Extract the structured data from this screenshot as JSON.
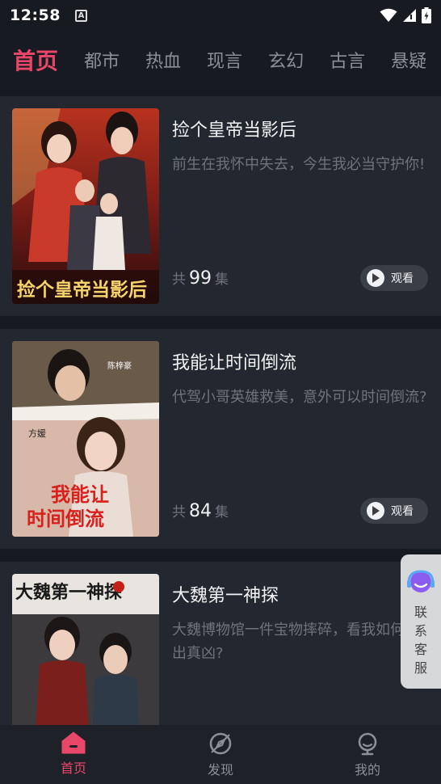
{
  "status": {
    "time": "12:58",
    "badge": "A"
  },
  "tabs": [
    {
      "label": "首页"
    },
    {
      "label": "都市"
    },
    {
      "label": "热血"
    },
    {
      "label": "现言"
    },
    {
      "label": "玄幻"
    },
    {
      "label": "古言"
    },
    {
      "label": "悬疑"
    }
  ],
  "dramas": [
    {
      "title": "捡个皇帝当影后",
      "desc": "前生在我怀中失去，今生我必当守护你!",
      "episodes_prefix": "共",
      "episodes": "99",
      "episodes_suffix": "集",
      "watch_label": "观看",
      "poster_text": "捡个皇帝当影后"
    },
    {
      "title": "我能让时间倒流",
      "desc": "代驾小哥英雄救美，意外可以时间倒流?",
      "episodes_prefix": "共",
      "episodes": "84",
      "episodes_suffix": "集",
      "watch_label": "观看",
      "poster_text": "我能让时间倒流"
    },
    {
      "title": "大魏第一神探",
      "desc": "大魏博物馆一件宝物摔碎，看我如何找出真凶?",
      "poster_text": "大魏第一神探"
    }
  ],
  "service": {
    "label": "联系客服"
  },
  "bottom_nav": [
    {
      "label": "首页",
      "icon": "home-icon"
    },
    {
      "label": "发现",
      "icon": "compass-icon"
    },
    {
      "label": "我的",
      "icon": "profile-icon"
    }
  ],
  "colors": {
    "accent": "#e8476a",
    "background": "#171a20",
    "card": "#222730"
  }
}
